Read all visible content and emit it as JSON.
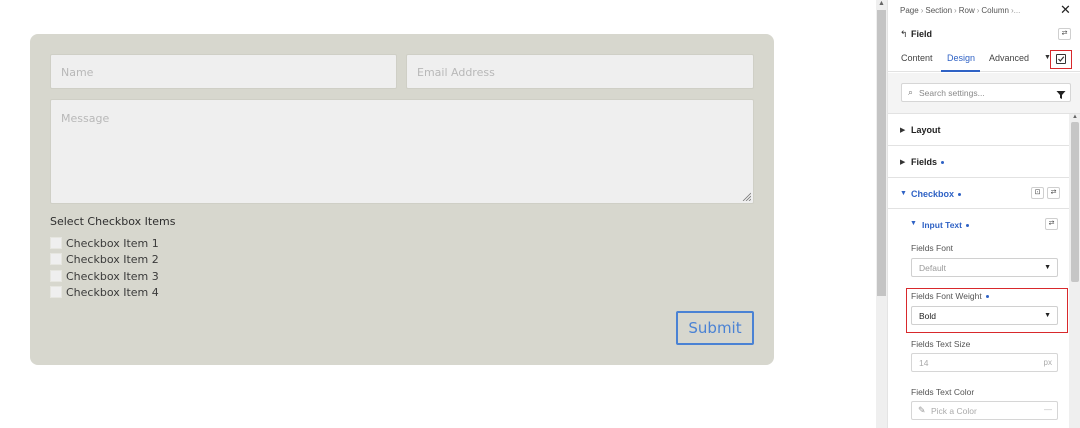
{
  "preview": {
    "form": {
      "name_placeholder": "Name",
      "email_placeholder": "Email Address",
      "message_placeholder": "Message",
      "checkbox_heading": "Select Checkbox Items",
      "checkbox_items": [
        "Checkbox Item 1",
        "Checkbox Item 2",
        "Checkbox Item 3",
        "Checkbox Item 4"
      ],
      "submit_label": "Submit"
    }
  },
  "panel": {
    "breadcrumb": [
      "Page",
      "Section",
      "Row",
      "Column"
    ],
    "breadcrumb_more": "›...",
    "title": "Field",
    "tabs": [
      {
        "label": "Content",
        "active": false
      },
      {
        "label": "Design",
        "active": true
      },
      {
        "label": "Advanced",
        "active": false
      }
    ],
    "search_placeholder": "Search settings...",
    "sections": [
      {
        "label": "Layout",
        "expanded": false,
        "modified": false
      },
      {
        "label": "Fields",
        "expanded": false,
        "modified": true
      },
      {
        "label": "Checkbox",
        "expanded": true,
        "modified": true
      }
    ],
    "subsection": {
      "label": "Input Text",
      "modified": true
    },
    "settings": {
      "fields_font_label": "Fields Font",
      "fields_font_value": "Default",
      "fields_font_weight_label": "Fields Font Weight",
      "fields_font_weight_value": "Bold",
      "fields_text_size_label": "Fields Text Size",
      "fields_text_size_value": "14",
      "fields_text_size_unit": "px",
      "fields_text_color_label": "Fields Text Color",
      "fields_text_color_placeholder": "Pick a Color"
    },
    "colors": {
      "accent": "#2f62c5",
      "highlight": "#d8292c",
      "form_bg": "#d7d7ce",
      "submit_border": "#4a82d4"
    }
  }
}
